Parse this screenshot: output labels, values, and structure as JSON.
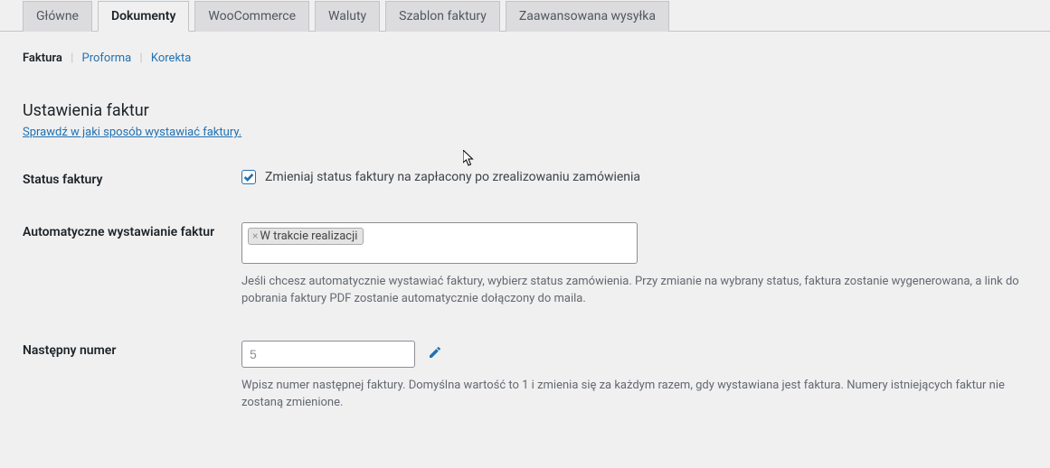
{
  "tabs": [
    {
      "label": "Główne"
    },
    {
      "label": "Dokumenty"
    },
    {
      "label": "WooCommerce"
    },
    {
      "label": "Waluty"
    },
    {
      "label": "Szablon faktury"
    },
    {
      "label": "Zaawansowana wysyłka"
    }
  ],
  "active_tab_index": 1,
  "subnav": {
    "items": [
      {
        "label": "Faktura"
      },
      {
        "label": "Proforma"
      },
      {
        "label": "Korekta"
      }
    ],
    "active_index": 0
  },
  "section": {
    "title": "Ustawienia faktur",
    "help_link": "Sprawdź w jaki sposób wystawiać faktury."
  },
  "fields": {
    "status": {
      "label": "Status faktury",
      "checkbox_label": "Zmieniaj status faktury na zapłacony po zrealizowaniu zamówienia",
      "checked": true
    },
    "auto": {
      "label": "Automatyczne wystawianie faktur",
      "tag": "W trakcie realizacji",
      "description": "Jeśli chcesz automatycznie wystawiać faktury, wybierz status zamówienia. Przy zmianie na wybrany status, faktura zostanie wygenerowana, a link do pobrania faktury PDF zostanie automatycznie dołączony do maila."
    },
    "next_number": {
      "label": "Następny numer",
      "value": "5",
      "description": "Wpisz numer następnej faktury. Domyślna wartość to 1 i zmienia się za każdym razem, gdy wystawiana jest faktura. Numery istniejących faktur nie zostaną zmienione."
    }
  }
}
